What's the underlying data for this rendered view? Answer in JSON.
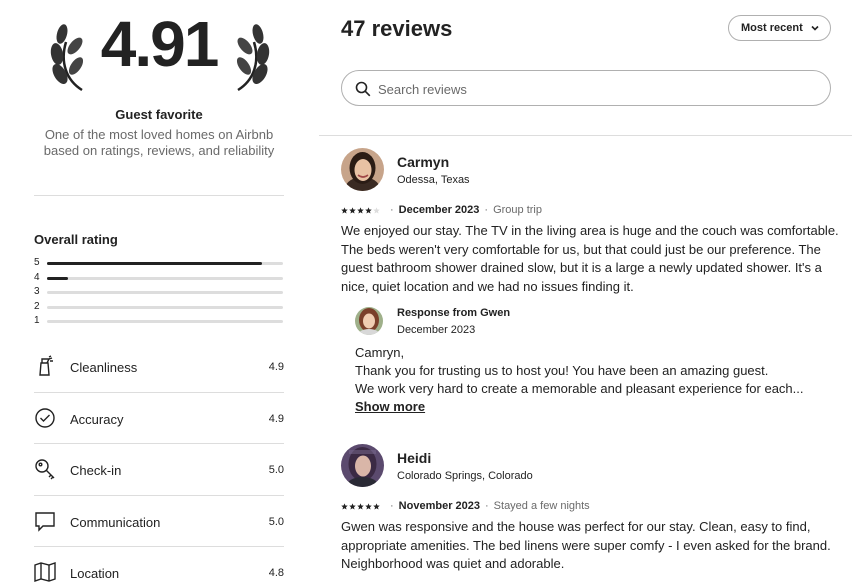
{
  "summary": {
    "rating": "4.91",
    "badge": "Guest favorite",
    "description": "One of the most loved homes on Airbnb based on ratings, reviews, and reliability"
  },
  "overall": {
    "label": "Overall rating",
    "distribution": [
      {
        "star": "5",
        "fraction": 0.91
      },
      {
        "star": "4",
        "fraction": 0.09
      },
      {
        "star": "3",
        "fraction": 0
      },
      {
        "star": "2",
        "fraction": 0
      },
      {
        "star": "1",
        "fraction": 0
      }
    ]
  },
  "categories": [
    {
      "label": "Cleanliness",
      "value": "4.9",
      "icon": "spray-bottle-icon"
    },
    {
      "label": "Accuracy",
      "value": "4.9",
      "icon": "check-circle-icon"
    },
    {
      "label": "Check-in",
      "value": "5.0",
      "icon": "key-icon"
    },
    {
      "label": "Communication",
      "value": "5.0",
      "icon": "chat-bubble-icon"
    },
    {
      "label": "Location",
      "value": "4.8",
      "icon": "map-icon"
    }
  ],
  "header": {
    "title": "47 reviews",
    "sort_label": "Most recent",
    "search_placeholder": "Search reviews"
  },
  "reviews": [
    {
      "name": "Carmyn",
      "location": "Odessa, Texas",
      "stars": 4,
      "date": "December 2023",
      "trip_type": "Group trip",
      "body": "We enjoyed our stay. The TV in the living area is huge and the couch was comfortable. The beds weren't very comfortable for us, but that could just be our preference. The guest bathroom shower drained slow, but it is a large a newly updated shower. It's a nice, quiet location and we had no issues finding it.",
      "response": {
        "from": "Response from Gwen",
        "date": "December 2023",
        "lines": [
          "Camryn,",
          "Thank you for trusting us to host you! You have been an amazing guest.",
          "We work very hard to create a memorable and pleasant experience for each..."
        ],
        "show_more": "Show more"
      }
    },
    {
      "name": "Heidi",
      "location": "Colorado Springs, Colorado",
      "stars": 5,
      "date": "November 2023",
      "trip_type": "Stayed a few nights",
      "body": "Gwen was responsive and the house was perfect for our stay. Clean, easy to find, appropriate amenities. The bed linens were super comfy - I even asked for the brand. Neighborhood was quiet and adorable."
    }
  ],
  "colors": {
    "text": "#222222",
    "muted": "#6a6a6a",
    "divider": "#dddddd"
  }
}
